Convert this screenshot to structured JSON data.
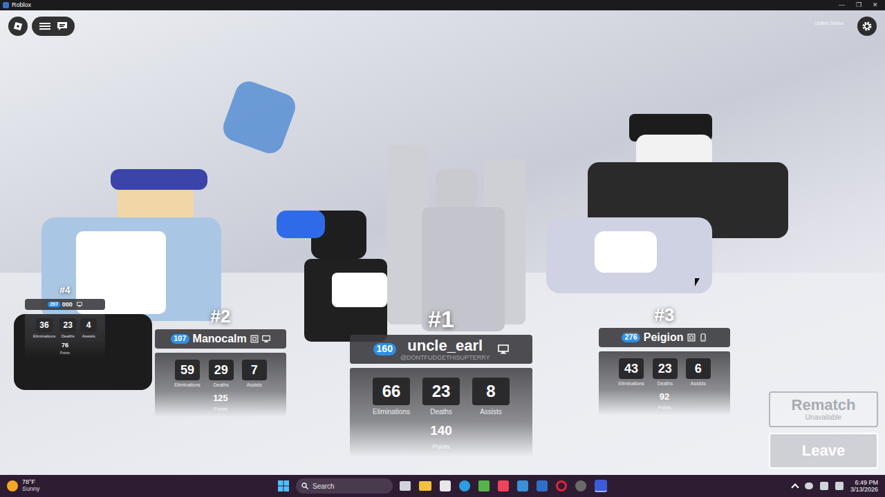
{
  "window": {
    "title": "Roblox",
    "controls": [
      "—",
      "❐",
      "✕"
    ]
  },
  "hud": {
    "region": "United States"
  },
  "podium": [
    {
      "rank": "#4",
      "kind": "small",
      "level": "297",
      "name": "000",
      "handle": "",
      "verified": false,
      "device": "pc",
      "stats": [
        {
          "value": "36",
          "label": "Eliminations"
        },
        {
          "value": "23",
          "label": "Deaths"
        },
        {
          "value": "4",
          "label": "Assists"
        }
      ],
      "points": "76",
      "points_label": "Points"
    },
    {
      "rank": "#2",
      "kind": "mid",
      "level": "107",
      "name": "Manocalm",
      "handle": "",
      "verified": true,
      "device": "pc",
      "stats": [
        {
          "value": "59",
          "label": "Eliminations"
        },
        {
          "value": "29",
          "label": "Deaths"
        },
        {
          "value": "7",
          "label": "Assists"
        }
      ],
      "points": "125",
      "points_label": "Points"
    },
    {
      "rank": "#1",
      "kind": "first",
      "level": "160",
      "name": "uncle_earl",
      "handle": "@DONTFUDGETHISUPTERRY",
      "verified": false,
      "device": "pc",
      "stats": [
        {
          "value": "66",
          "label": "Eliminations"
        },
        {
          "value": "23",
          "label": "Deaths"
        },
        {
          "value": "8",
          "label": "Assists"
        }
      ],
      "points": "140",
      "points_label": "Points"
    },
    {
      "rank": "#3",
      "kind": "mid",
      "level": "276",
      "name": "Peigion",
      "handle": "",
      "verified": true,
      "device": "mobile",
      "stats": [
        {
          "value": "43",
          "label": "Eliminations"
        },
        {
          "value": "23",
          "label": "Deaths"
        },
        {
          "value": "6",
          "label": "Assists"
        }
      ],
      "points": "92",
      "points_label": "Points"
    }
  ],
  "buttons": [
    {
      "label": "Rematch",
      "sublabel": "Unavailable",
      "disabled": true
    },
    {
      "label": "Leave",
      "sublabel": "",
      "disabled": false
    }
  ],
  "taskbar": {
    "temperature": "78°F",
    "weather": "Sunny",
    "search": "Search",
    "time": "6:49 PM",
    "date": "3/13/2026"
  }
}
